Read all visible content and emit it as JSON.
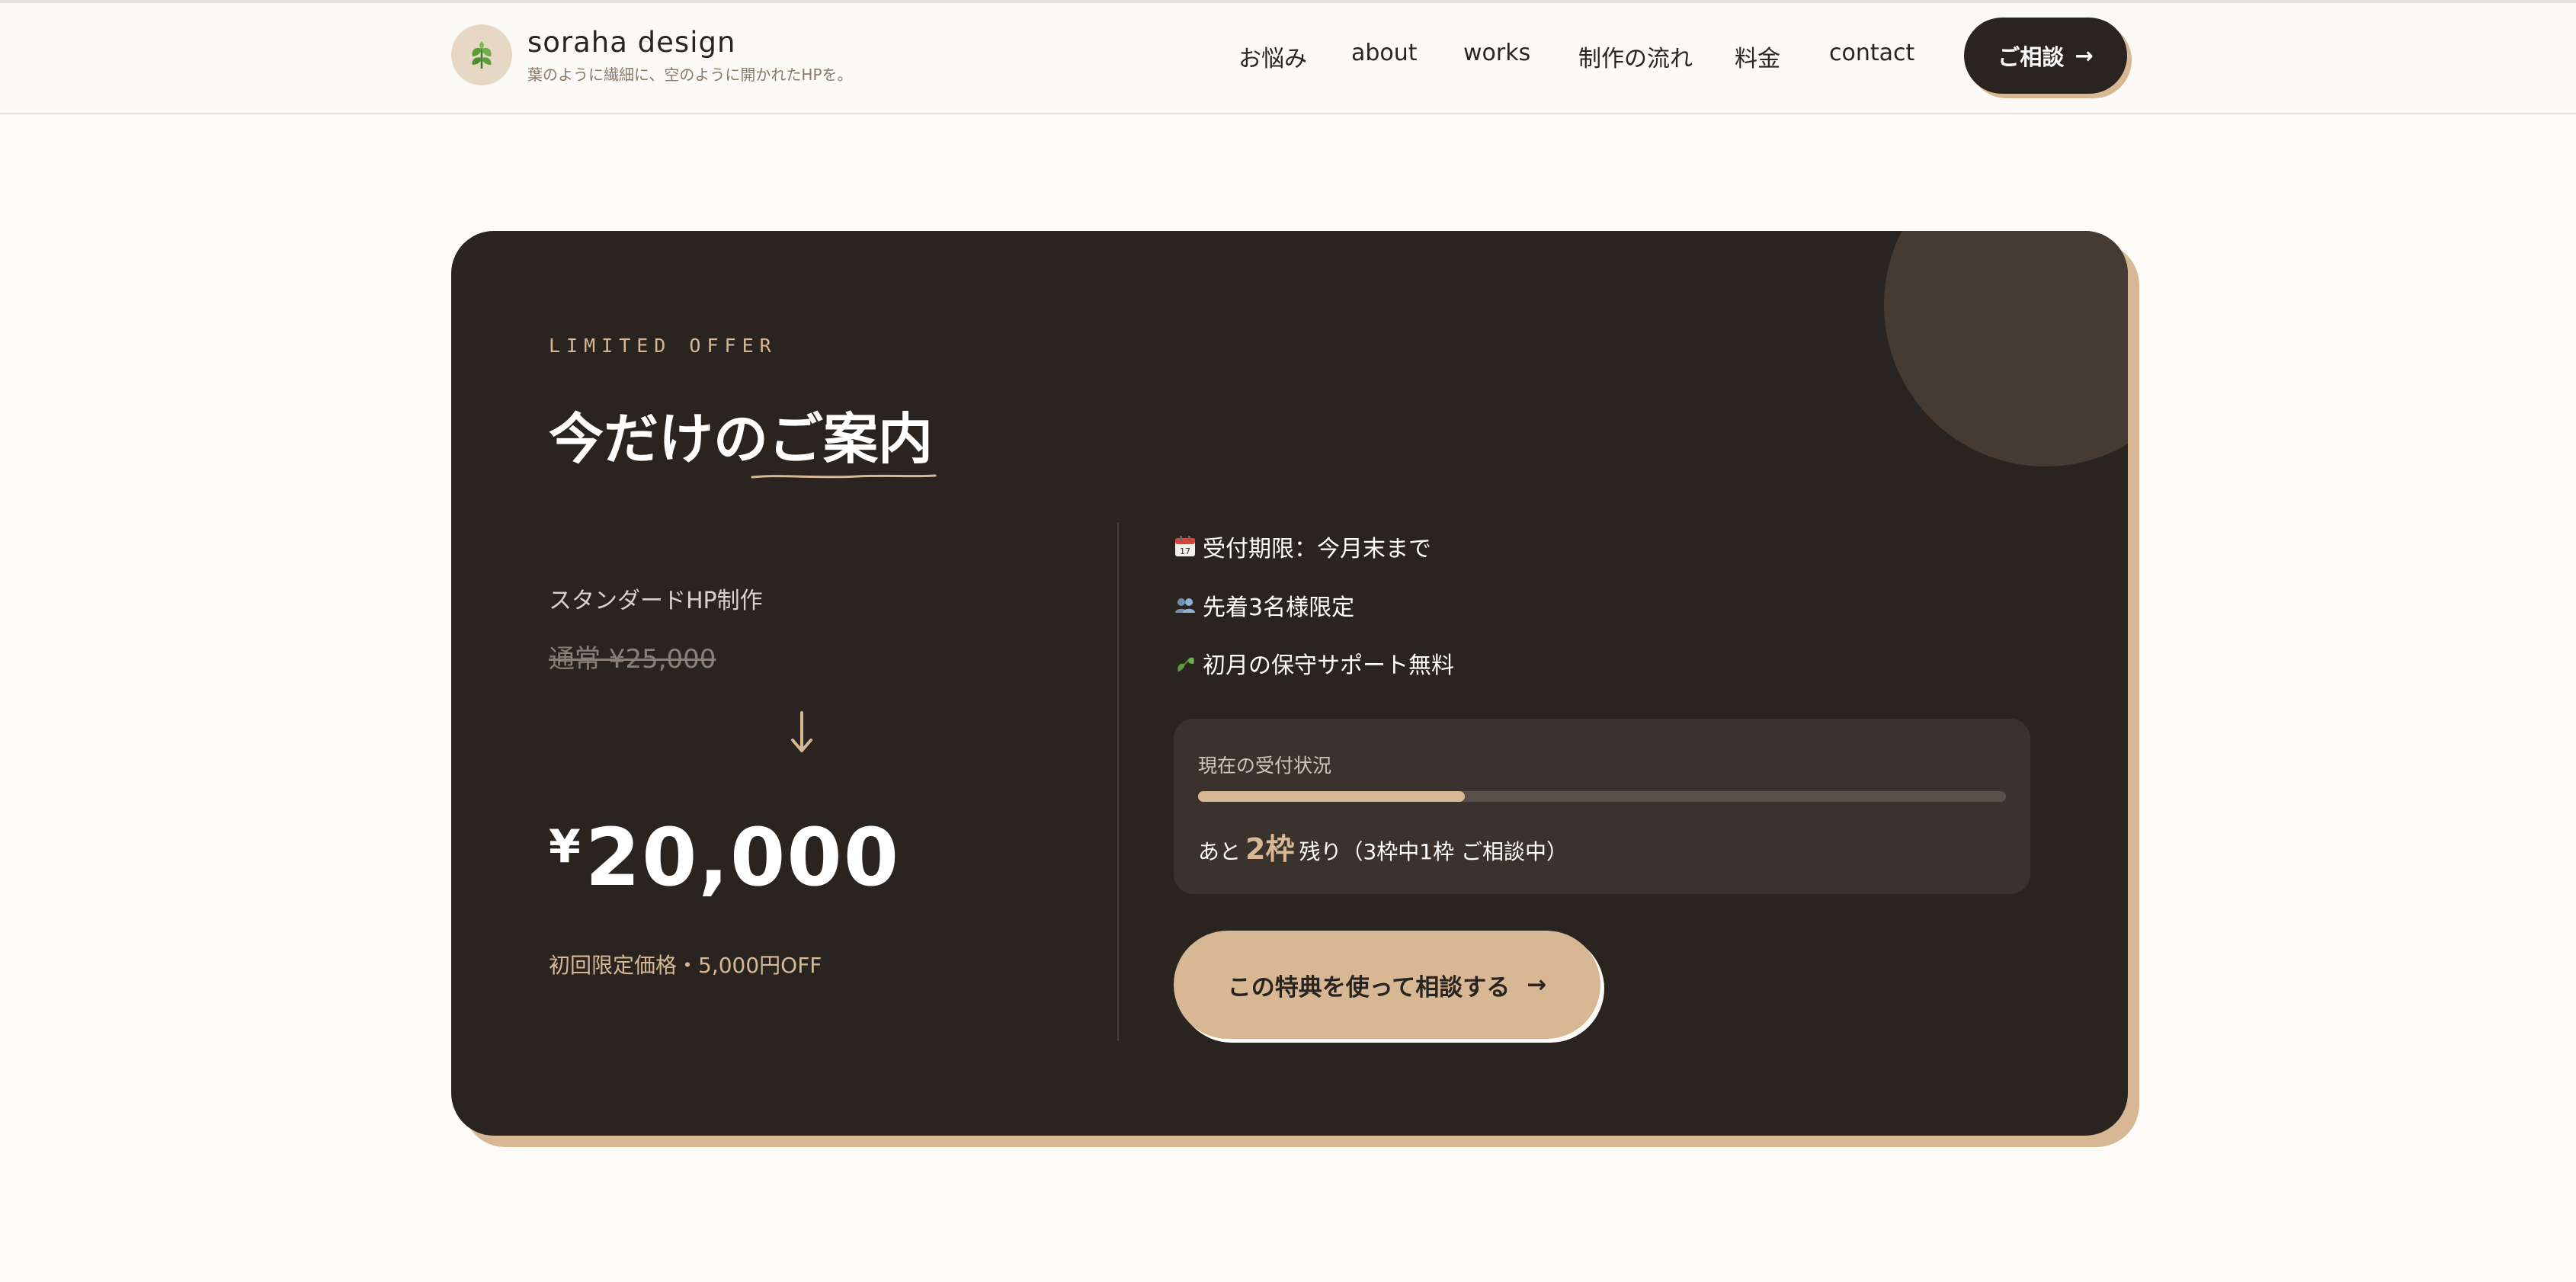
{
  "header": {
    "brand_name": "soraha design",
    "brand_tagline": "葉のように繊細に、空のように開かれたHPを。",
    "logo_icon": "leaf-icon",
    "nav": [
      {
        "label": "お悩み"
      },
      {
        "label": "about"
      },
      {
        "label": "works"
      },
      {
        "label": "制作の流れ"
      },
      {
        "label": "料金"
      },
      {
        "label": "contact"
      }
    ],
    "cta_label": "ご相談",
    "cta_arrow": "→"
  },
  "offer": {
    "eyebrow": "LIMITED OFFER",
    "title_part1": "今だけの",
    "title_part2": "ご案内",
    "plan_name": "スタンダードHP制作",
    "old_price": "通常 ¥25,000",
    "arrow": "↓",
    "price_yen": "¥",
    "price_value": "20,000",
    "price_note": "初回限定価格・5,000円OFF",
    "features": [
      {
        "icon": "calendar-icon",
        "text": "受付期限：今月末まで"
      },
      {
        "icon": "people-icon",
        "text": "先着3名様限定"
      },
      {
        "icon": "leaf-icon",
        "text": "初月の保守サポート無料"
      }
    ],
    "status": {
      "label": "現在の受付状況",
      "progress": 0.33,
      "prefix": "あと",
      "remaining": "2枠",
      "suffix": "残り（3枠中1枠 ご相談中）"
    },
    "cta_label": "この特典を使って相談する",
    "cta_arrow": "→"
  },
  "colors": {
    "card_bg": "#2a2420",
    "accent": "#d8b894",
    "page_bg": "#fdfbf7"
  }
}
